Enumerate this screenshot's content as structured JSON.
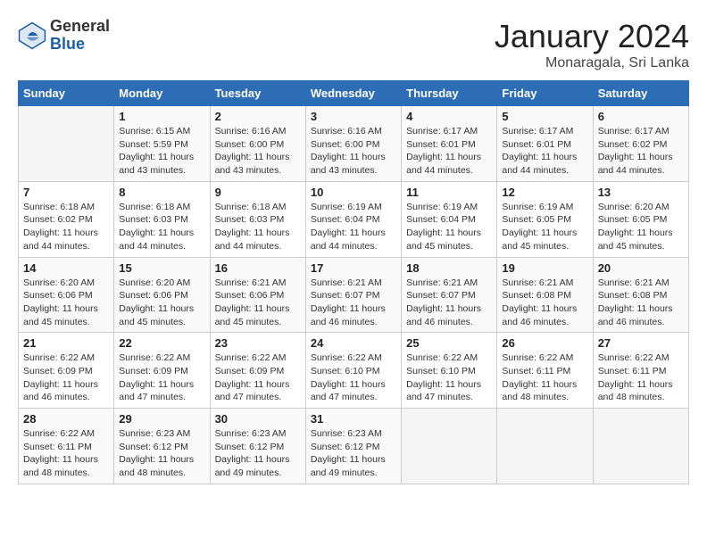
{
  "header": {
    "logo_general": "General",
    "logo_blue": "Blue",
    "month_title": "January 2024",
    "location": "Monaragala, Sri Lanka"
  },
  "weekdays": [
    "Sunday",
    "Monday",
    "Tuesday",
    "Wednesday",
    "Thursday",
    "Friday",
    "Saturday"
  ],
  "weeks": [
    [
      {
        "day": "",
        "info": ""
      },
      {
        "day": "1",
        "info": "Sunrise: 6:15 AM\nSunset: 5:59 PM\nDaylight: 11 hours\nand 43 minutes."
      },
      {
        "day": "2",
        "info": "Sunrise: 6:16 AM\nSunset: 6:00 PM\nDaylight: 11 hours\nand 43 minutes."
      },
      {
        "day": "3",
        "info": "Sunrise: 6:16 AM\nSunset: 6:00 PM\nDaylight: 11 hours\nand 43 minutes."
      },
      {
        "day": "4",
        "info": "Sunrise: 6:17 AM\nSunset: 6:01 PM\nDaylight: 11 hours\nand 44 minutes."
      },
      {
        "day": "5",
        "info": "Sunrise: 6:17 AM\nSunset: 6:01 PM\nDaylight: 11 hours\nand 44 minutes."
      },
      {
        "day": "6",
        "info": "Sunrise: 6:17 AM\nSunset: 6:02 PM\nDaylight: 11 hours\nand 44 minutes."
      }
    ],
    [
      {
        "day": "7",
        "info": "Sunrise: 6:18 AM\nSunset: 6:02 PM\nDaylight: 11 hours\nand 44 minutes."
      },
      {
        "day": "8",
        "info": "Sunrise: 6:18 AM\nSunset: 6:03 PM\nDaylight: 11 hours\nand 44 minutes."
      },
      {
        "day": "9",
        "info": "Sunrise: 6:18 AM\nSunset: 6:03 PM\nDaylight: 11 hours\nand 44 minutes."
      },
      {
        "day": "10",
        "info": "Sunrise: 6:19 AM\nSunset: 6:04 PM\nDaylight: 11 hours\nand 44 minutes."
      },
      {
        "day": "11",
        "info": "Sunrise: 6:19 AM\nSunset: 6:04 PM\nDaylight: 11 hours\nand 45 minutes."
      },
      {
        "day": "12",
        "info": "Sunrise: 6:19 AM\nSunset: 6:05 PM\nDaylight: 11 hours\nand 45 minutes."
      },
      {
        "day": "13",
        "info": "Sunrise: 6:20 AM\nSunset: 6:05 PM\nDaylight: 11 hours\nand 45 minutes."
      }
    ],
    [
      {
        "day": "14",
        "info": "Sunrise: 6:20 AM\nSunset: 6:06 PM\nDaylight: 11 hours\nand 45 minutes."
      },
      {
        "day": "15",
        "info": "Sunrise: 6:20 AM\nSunset: 6:06 PM\nDaylight: 11 hours\nand 45 minutes."
      },
      {
        "day": "16",
        "info": "Sunrise: 6:21 AM\nSunset: 6:06 PM\nDaylight: 11 hours\nand 45 minutes."
      },
      {
        "day": "17",
        "info": "Sunrise: 6:21 AM\nSunset: 6:07 PM\nDaylight: 11 hours\nand 46 minutes."
      },
      {
        "day": "18",
        "info": "Sunrise: 6:21 AM\nSunset: 6:07 PM\nDaylight: 11 hours\nand 46 minutes."
      },
      {
        "day": "19",
        "info": "Sunrise: 6:21 AM\nSunset: 6:08 PM\nDaylight: 11 hours\nand 46 minutes."
      },
      {
        "day": "20",
        "info": "Sunrise: 6:21 AM\nSunset: 6:08 PM\nDaylight: 11 hours\nand 46 minutes."
      }
    ],
    [
      {
        "day": "21",
        "info": "Sunrise: 6:22 AM\nSunset: 6:09 PM\nDaylight: 11 hours\nand 46 minutes."
      },
      {
        "day": "22",
        "info": "Sunrise: 6:22 AM\nSunset: 6:09 PM\nDaylight: 11 hours\nand 47 minutes."
      },
      {
        "day": "23",
        "info": "Sunrise: 6:22 AM\nSunset: 6:09 PM\nDaylight: 11 hours\nand 47 minutes."
      },
      {
        "day": "24",
        "info": "Sunrise: 6:22 AM\nSunset: 6:10 PM\nDaylight: 11 hours\nand 47 minutes."
      },
      {
        "day": "25",
        "info": "Sunrise: 6:22 AM\nSunset: 6:10 PM\nDaylight: 11 hours\nand 47 minutes."
      },
      {
        "day": "26",
        "info": "Sunrise: 6:22 AM\nSunset: 6:11 PM\nDaylight: 11 hours\nand 48 minutes."
      },
      {
        "day": "27",
        "info": "Sunrise: 6:22 AM\nSunset: 6:11 PM\nDaylight: 11 hours\nand 48 minutes."
      }
    ],
    [
      {
        "day": "28",
        "info": "Sunrise: 6:22 AM\nSunset: 6:11 PM\nDaylight: 11 hours\nand 48 minutes."
      },
      {
        "day": "29",
        "info": "Sunrise: 6:23 AM\nSunset: 6:12 PM\nDaylight: 11 hours\nand 48 minutes."
      },
      {
        "day": "30",
        "info": "Sunrise: 6:23 AM\nSunset: 6:12 PM\nDaylight: 11 hours\nand 49 minutes."
      },
      {
        "day": "31",
        "info": "Sunrise: 6:23 AM\nSunset: 6:12 PM\nDaylight: 11 hours\nand 49 minutes."
      },
      {
        "day": "",
        "info": ""
      },
      {
        "day": "",
        "info": ""
      },
      {
        "day": "",
        "info": ""
      }
    ]
  ]
}
